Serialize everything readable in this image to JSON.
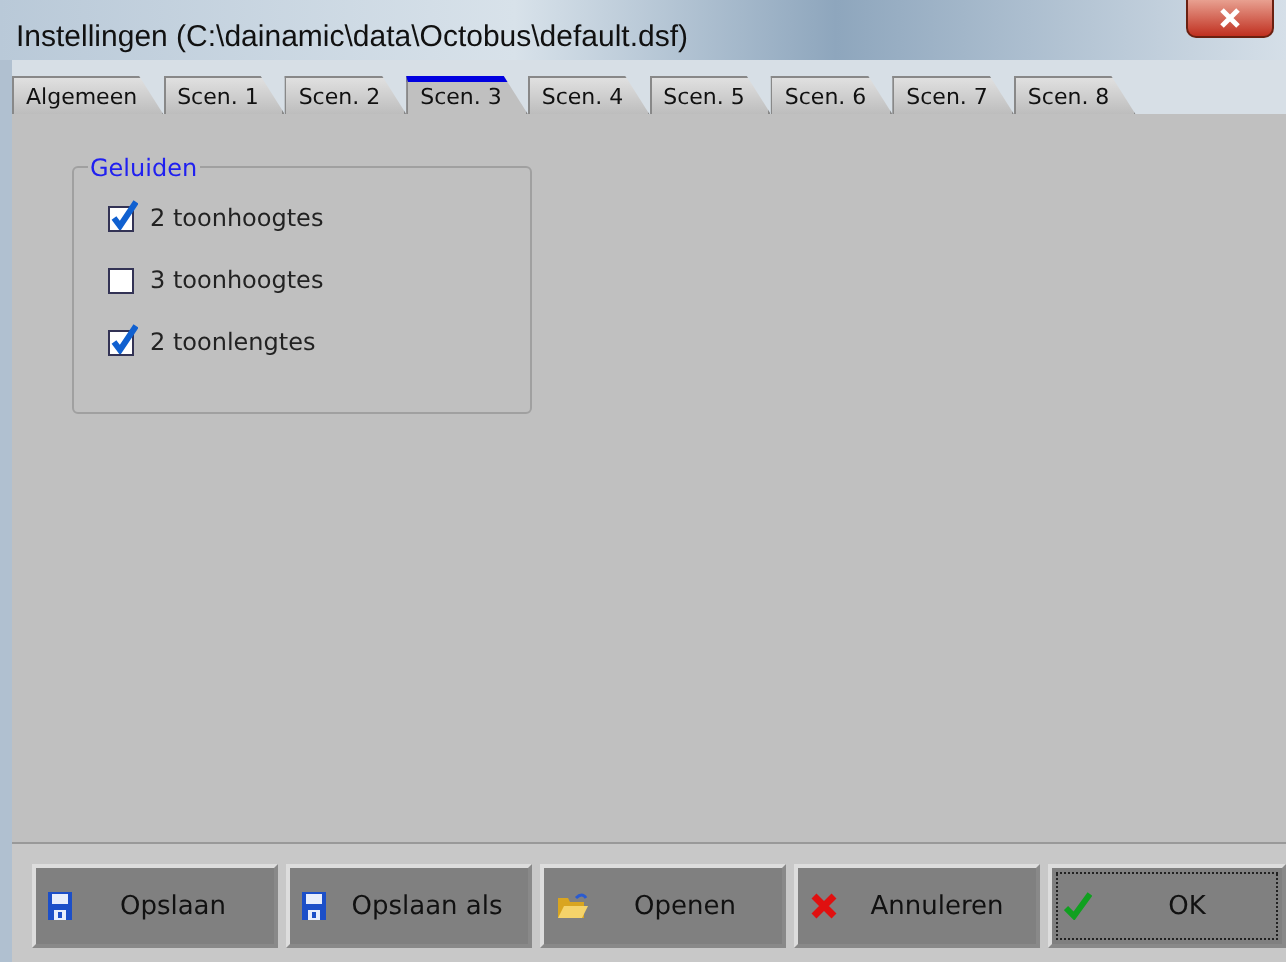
{
  "window": {
    "title": "Instellingen (C:\\dainamic\\data\\Octobus\\default.dsf)"
  },
  "tabs": [
    {
      "label": "Algemeen",
      "selected": false
    },
    {
      "label": "Scen. 1",
      "selected": false
    },
    {
      "label": "Scen. 2",
      "selected": false
    },
    {
      "label": "Scen. 3",
      "selected": true
    },
    {
      "label": "Scen. 4",
      "selected": false
    },
    {
      "label": "Scen. 5",
      "selected": false
    },
    {
      "label": "Scen. 6",
      "selected": false
    },
    {
      "label": "Scen. 7",
      "selected": false
    },
    {
      "label": "Scen. 8",
      "selected": false
    }
  ],
  "group": {
    "title": "Geluiden",
    "options": [
      {
        "label": "2 toonhoogtes",
        "checked": true
      },
      {
        "label": "3 toonhoogtes",
        "checked": false
      },
      {
        "label": "2 toonlengtes",
        "checked": true
      }
    ]
  },
  "buttons": [
    {
      "label": "Opslaan",
      "kind": "save",
      "focused": false
    },
    {
      "label": "Opslaan als",
      "kind": "save",
      "focused": false
    },
    {
      "label": "Openen",
      "kind": "open",
      "focused": false
    },
    {
      "label": "Annuleren",
      "kind": "cancel",
      "focused": false
    },
    {
      "label": "OK",
      "kind": "ok",
      "focused": true
    }
  ]
}
